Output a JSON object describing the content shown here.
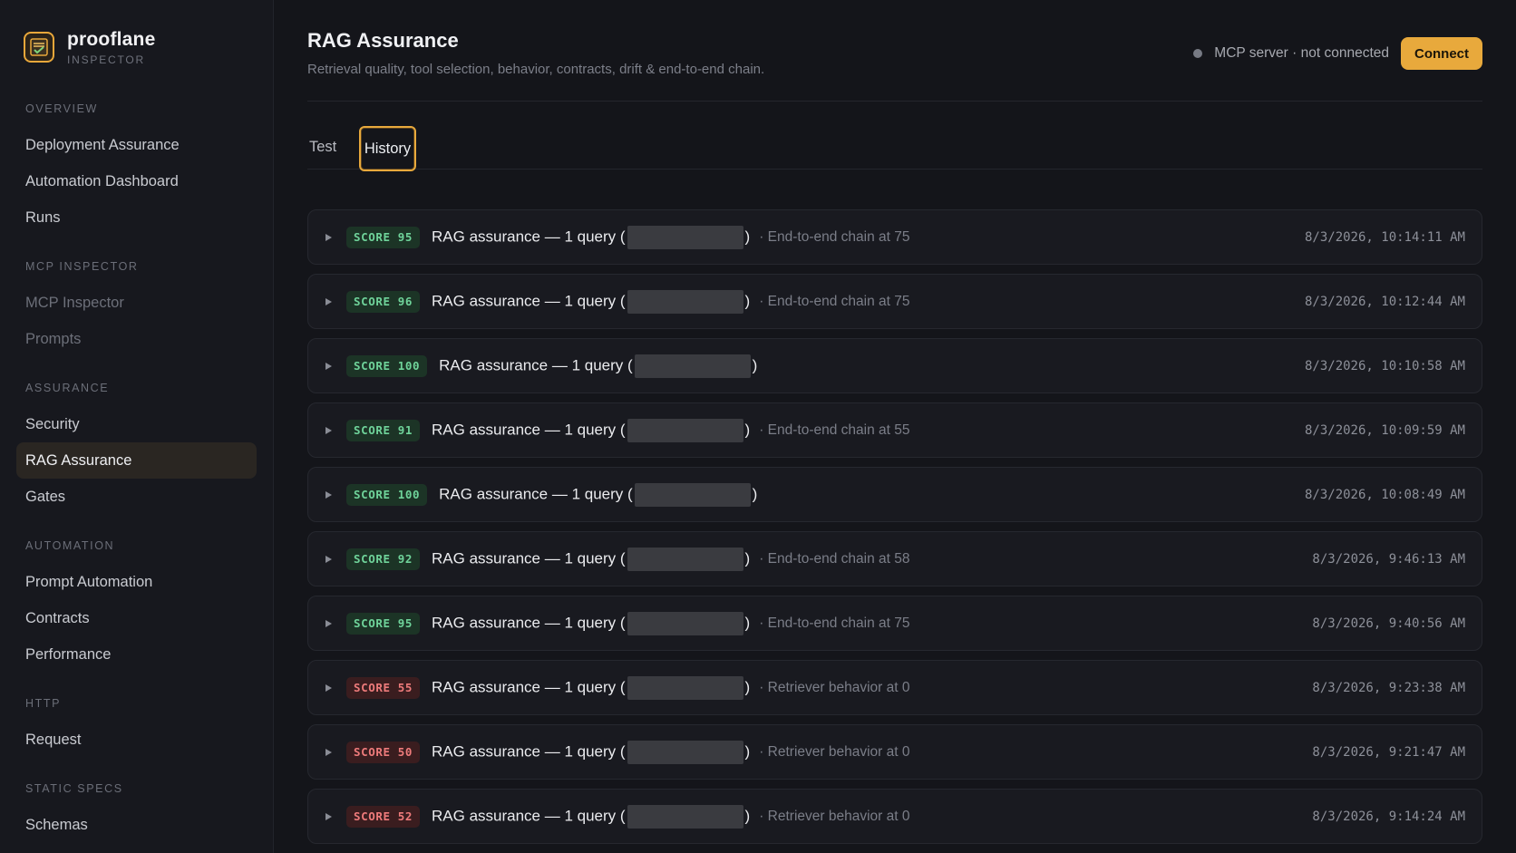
{
  "brand": {
    "name": "prooflane",
    "subtitle": "INSPECTOR"
  },
  "nav": [
    {
      "heading": "OVERVIEW",
      "items": [
        {
          "label": "Deployment Assurance",
          "state": "normal"
        },
        {
          "label": "Automation Dashboard",
          "state": "normal"
        },
        {
          "label": "Runs",
          "state": "normal"
        }
      ]
    },
    {
      "heading": "MCP INSPECTOR",
      "items": [
        {
          "label": "MCP Inspector",
          "state": "dim"
        },
        {
          "label": "Prompts",
          "state": "dim"
        }
      ]
    },
    {
      "heading": "ASSURANCE",
      "items": [
        {
          "label": "Security",
          "state": "normal"
        },
        {
          "label": "RAG Assurance",
          "state": "active"
        },
        {
          "label": "Gates",
          "state": "normal"
        }
      ]
    },
    {
      "heading": "AUTOMATION",
      "items": [
        {
          "label": "Prompt Automation",
          "state": "normal"
        },
        {
          "label": "Contracts",
          "state": "normal"
        },
        {
          "label": "Performance",
          "state": "normal"
        }
      ]
    },
    {
      "heading": "HTTP",
      "items": [
        {
          "label": "Request",
          "state": "normal"
        }
      ]
    },
    {
      "heading": "STATIC SPECS",
      "items": [
        {
          "label": "Schemas",
          "state": "normal"
        }
      ]
    }
  ],
  "header": {
    "title": "RAG Assurance",
    "subtitle": "Retrieval quality, tool selection, behavior, contracts, drift & end-to-end chain.",
    "connection_status": "MCP server · not connected",
    "connect_label": "Connect"
  },
  "tabs": {
    "test": "Test",
    "history": "History",
    "active": "history"
  },
  "colors": {
    "accent": "#e8a93c",
    "good": "#6fd39a",
    "bad": "#ee7b7b"
  },
  "history": [
    {
      "score": "SCORE 95",
      "level": "good",
      "title_prefix": "RAG assurance — 1 query (",
      "title_suffix": ")",
      "note": "· End-to-end chain at 75",
      "time": "8/3/2026, 10:14:11 AM"
    },
    {
      "score": "SCORE 96",
      "level": "good",
      "title_prefix": "RAG assurance — 1 query (",
      "title_suffix": ")",
      "note": "· End-to-end chain at 75",
      "time": "8/3/2026, 10:12:44 AM"
    },
    {
      "score": "SCORE 100",
      "level": "good",
      "title_prefix": "RAG assurance — 1 query (",
      "title_suffix": ")",
      "note": "",
      "time": "8/3/2026, 10:10:58 AM"
    },
    {
      "score": "SCORE 91",
      "level": "good",
      "title_prefix": "RAG assurance — 1 query (",
      "title_suffix": ")",
      "note": "· End-to-end chain at 55",
      "time": "8/3/2026, 10:09:59 AM"
    },
    {
      "score": "SCORE 100",
      "level": "good",
      "title_prefix": "RAG assurance — 1 query (",
      "title_suffix": ")",
      "note": "",
      "time": "8/3/2026, 10:08:49 AM"
    },
    {
      "score": "SCORE 92",
      "level": "good",
      "title_prefix": "RAG assurance — 1 query (",
      "title_suffix": ")",
      "note": "· End-to-end chain at 58",
      "time": "8/3/2026, 9:46:13 AM"
    },
    {
      "score": "SCORE 95",
      "level": "good",
      "title_prefix": "RAG assurance — 1 query (",
      "title_suffix": ")",
      "note": "· End-to-end chain at 75",
      "time": "8/3/2026, 9:40:56 AM"
    },
    {
      "score": "SCORE 55",
      "level": "bad",
      "title_prefix": "RAG assurance — 1 query (",
      "title_suffix": ")",
      "note": "· Retriever behavior at 0",
      "time": "8/3/2026, 9:23:38 AM"
    },
    {
      "score": "SCORE 50",
      "level": "bad",
      "title_prefix": "RAG assurance — 1 query (",
      "title_suffix": ")",
      "note": "· Retriever behavior at 0",
      "time": "8/3/2026, 9:21:47 AM"
    },
    {
      "score": "SCORE 52",
      "level": "bad",
      "title_prefix": "RAG assurance — 1 query (",
      "title_suffix": ")",
      "note": "· Retriever behavior at 0",
      "time": "8/3/2026, 9:14:24 AM"
    }
  ]
}
